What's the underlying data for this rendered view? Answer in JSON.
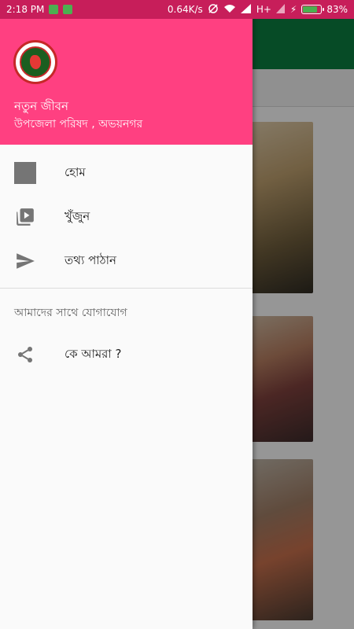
{
  "status_bar": {
    "time": "2:18 PM",
    "speed": "0.64K/s",
    "network": "H+",
    "battery": "83%",
    "battery_level": 0.83,
    "icons": [
      "notification-app-icon",
      "notification-battery-icon",
      "alarm-off-icon",
      "wifi-icon",
      "signal-icon",
      "charging-icon"
    ]
  },
  "drawer": {
    "header": {
      "title": "নতুন জীবন",
      "subtitle": "উপজেলা পরিষদ , অভয়নগর",
      "background": "#ff4081",
      "logo_icon": "govt-seal-logo"
    },
    "items": [
      {
        "label": "হোম",
        "icon": "home-square-icon"
      },
      {
        "label": "খুঁজুন",
        "icon": "video-library-icon"
      },
      {
        "label": "তথ্য পাঠান",
        "icon": "send-icon"
      }
    ],
    "section_title": "আমাদের সাথে যোগাযোগ",
    "section_items": [
      {
        "label": "কে আমরা ?",
        "icon": "share-icon"
      }
    ]
  },
  "background_app": {
    "toolbar_color": "#0b7a3e"
  }
}
